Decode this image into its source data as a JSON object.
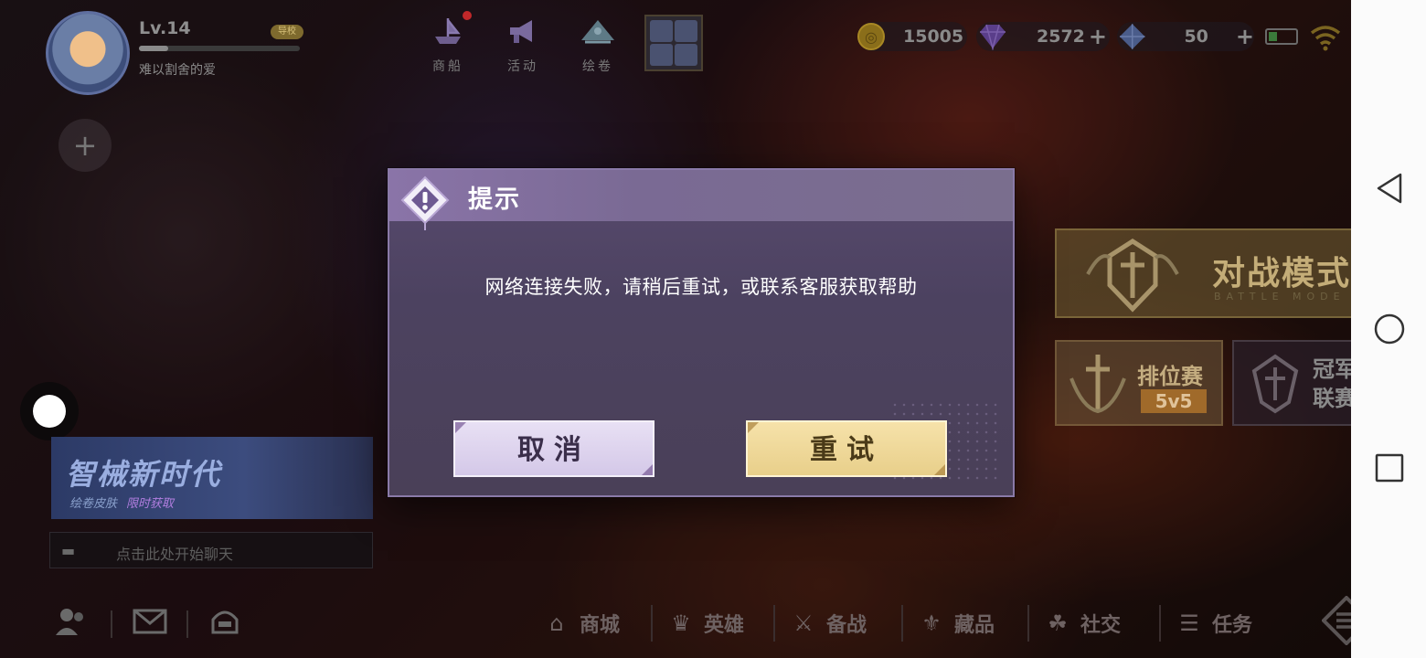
{
  "profile": {
    "level": "Lv.14",
    "level_badge": "导校",
    "nickname": "难以割舍的爱",
    "xp_progress_percent": 18
  },
  "top_menu": [
    {
      "label": "商船",
      "icon": "ship-icon"
    },
    {
      "label": "活动",
      "icon": "megaphone-icon"
    },
    {
      "label": "绘卷",
      "icon": "scroll-icon"
    }
  ],
  "currency": {
    "gold": "15005",
    "diamond": "2572",
    "crystal": "50"
  },
  "modal": {
    "title": "提示",
    "message": "网络连接失败，请稍后重试，或联系客服获取帮助",
    "cancel_label": "取消",
    "retry_label": "重试"
  },
  "battle": {
    "mode_title": "对战模式",
    "mode_subtitle": "BATTLE MODE",
    "ranked_title": "排位赛",
    "ranked_mode": "5v5",
    "league_title": "冠军联赛"
  },
  "banner": {
    "title": "智械新时代",
    "subtitle": "绘卷皮肤",
    "highlight": "限时获取"
  },
  "chat": {
    "placeholder": "点击此处开始聊天"
  },
  "bottom_nav": [
    {
      "label": "商城",
      "icon": "shop-icon"
    },
    {
      "label": "英雄",
      "icon": "hero-icon"
    },
    {
      "label": "备战",
      "icon": "prepare-icon"
    },
    {
      "label": "藏品",
      "icon": "collection-icon"
    },
    {
      "label": "社交",
      "icon": "social-icon"
    },
    {
      "label": "任务",
      "icon": "task-icon"
    }
  ],
  "colors": {
    "modal_bg": "#4c4260",
    "modal_header": "#8a74a8",
    "cancel_button": "#e0d6f0",
    "retry_button": "#f2dc9e"
  }
}
